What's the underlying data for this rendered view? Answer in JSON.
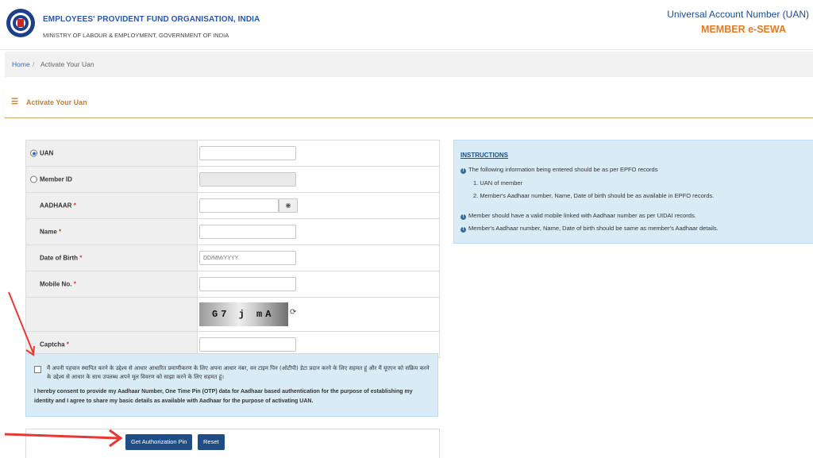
{
  "header": {
    "org_name": "EMPLOYEES' PROVIDENT FUND ORGANISATION, INDIA",
    "ministry": "MINISTRY OF LABOUR & EMPLOYMENT, GOVERNMENT OF INDIA",
    "uan_title": "Universal Account Number (UAN)",
    "portal_name": "MEMBER e-SEWA"
  },
  "breadcrumb": {
    "home": "Home",
    "separator": "/",
    "current": "Activate Your Uan"
  },
  "section": {
    "title": "Activate Your Uan",
    "icon": "hamburger-menu-icon"
  },
  "form": {
    "uan_label": "UAN",
    "member_id_label": "Member ID",
    "aadhaar_label": "AADHAAR",
    "name_label": "Name",
    "dob_label": "Date of Birth",
    "dob_placeholder": "DD/MM/YYYY",
    "mobile_label": "Mobile No.",
    "captcha_label": "Captcha",
    "captcha_text": "G7 j mA",
    "required_mark": "*",
    "selected_option": "UAN"
  },
  "consent": {
    "hindi": "मैं अपनी पहचान स्थापित करने के उद्देश्य से आधार आधारित प्रमाणीकरण के लिए अपना आधार नंबर, वन टाइम पिन (ओटीपी) डेटा प्रदान करने के लिए सहमत हूं और मैं यूएएन को सक्रिय करने के उद्देश्य से आधार के साथ उपलब्ध अपने मूल विवरण को साझा करने के लिए सहमत हूं।",
    "english": "I hereby consent to provide my Aadhaar Number, One Time Pin (OTP) data for Aadhaar based authentication for the purpose of establishing my identity and I agree to share my basic details as available with Aadhaar for the purpose of activating UAN."
  },
  "buttons": {
    "get_pin": "Get Authorization Pin",
    "reset": "Reset"
  },
  "instructions": {
    "title": "INSTRUCTIONS",
    "line1": "The following information being entered should be as per EPFO records",
    "item1": "1. UAN of member",
    "item2": "2. Member's Aadhaar number, Name, Date of birth should be as available in EPFO records.",
    "line2": "Member should have a valid mobile linked with Aadhaar number as per UIDAI records.",
    "line3": "Member's Aadhaar number, Name, Date of birth should be same as member's Aadhaar details."
  },
  "colors": {
    "brand_blue": "#1f4d86",
    "accent_orange": "#e07b24",
    "info_bg": "#d9ecf6",
    "annotation_red": "#e53935"
  }
}
